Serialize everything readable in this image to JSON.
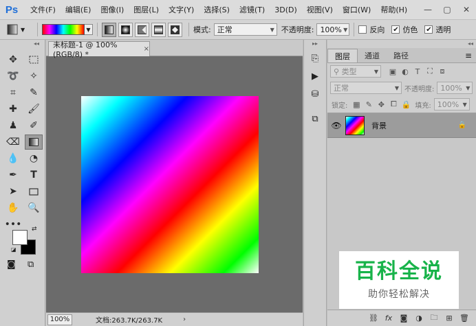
{
  "app": {
    "logo": "Ps"
  },
  "menu": [
    "文件(F)",
    "编辑(E)",
    "图像(I)",
    "图层(L)",
    "文字(Y)",
    "选择(S)",
    "滤镜(T)",
    "3D(D)",
    "视图(V)",
    "窗口(W)",
    "帮助(H)"
  ],
  "window_controls": {
    "minimize": "—",
    "restore": "▢",
    "close": "✕"
  },
  "options": {
    "mode_label": "模式:",
    "mode_value": "正常",
    "opacity_label": "不透明度:",
    "opacity_value": "100%",
    "reverse_label": "反向",
    "dither_label": "仿色",
    "transparency_label": "透明区域"
  },
  "document": {
    "tab_title": "未标题-1 @ 100%(RGB/8) *",
    "close": "×",
    "zoom": "100%",
    "info": "文档:263.7K/263.7K",
    "status_arrow": "›"
  },
  "layers_panel": {
    "tabs": [
      "图层",
      "通道",
      "路径"
    ],
    "filter_kind": "类型",
    "blend_mode": "正常",
    "opacity_label": "不透明度:",
    "opacity_value": "100%",
    "lock_label": "锁定:",
    "fill_label": "填充:",
    "fill_value": "100%",
    "layers": [
      {
        "name": "背景",
        "visible": true,
        "locked": true
      }
    ]
  },
  "watermark": {
    "title": "百科全说",
    "subtitle": "助你轻松解决"
  },
  "colors": {
    "foreground": "#ffffff",
    "background": "#000000",
    "accent": "#18b34a"
  }
}
